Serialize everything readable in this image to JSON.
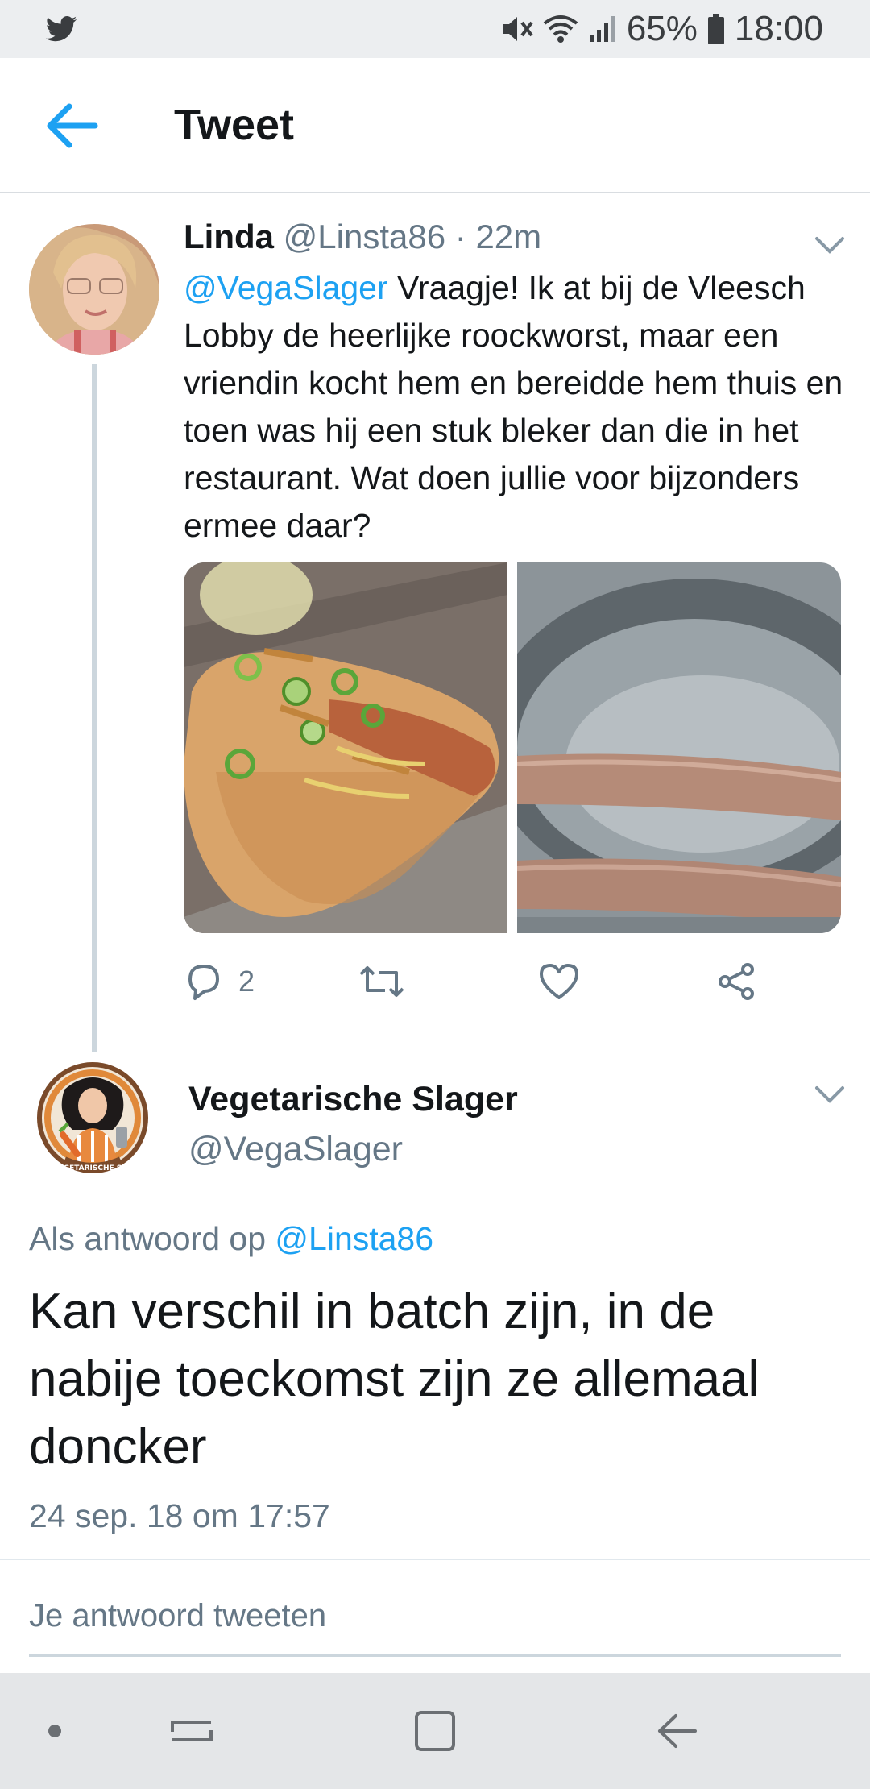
{
  "status_bar": {
    "battery": "65%",
    "time": "18:00",
    "icons": [
      "twitter-bird-icon",
      "mute-icon",
      "wifi-icon",
      "signal-icon",
      "battery-icon"
    ]
  },
  "header": {
    "title": "Tweet",
    "back_icon": "arrow-left-icon"
  },
  "tweet1": {
    "name": "Linda",
    "handle": "@Linsta86",
    "separator": " · ",
    "time": "22m",
    "mention": "@VegaSlager",
    "text": " Vraagje! Ik at bij de Vleesch Lobby de heerlijke roockworst, maar een vriendin kocht hem en bereidde hem thuis en toen was hij een stuk bleker dan die in het restaurant. Wat doen jullie voor bijzonders ermee daar?",
    "reply_count": "2"
  },
  "tweet2": {
    "name": "Vegetarische Slager",
    "handle": "@VegaSlager",
    "reply_prefix": "Als antwoord op ",
    "reply_handle": "@Linsta86",
    "text": "Kan verschil in batch zijn, in de nabije toeckomst zijn ze allemaal doncker",
    "timestamp": "24 sep. 18 om 17:57",
    "avatar_logo_text": "GETARISCHE S"
  },
  "compose": {
    "placeholder": "Je antwoord tweeten"
  },
  "colors": {
    "accent": "#1da1f2",
    "secondary_text": "#657786",
    "primary_text": "#14171a"
  }
}
